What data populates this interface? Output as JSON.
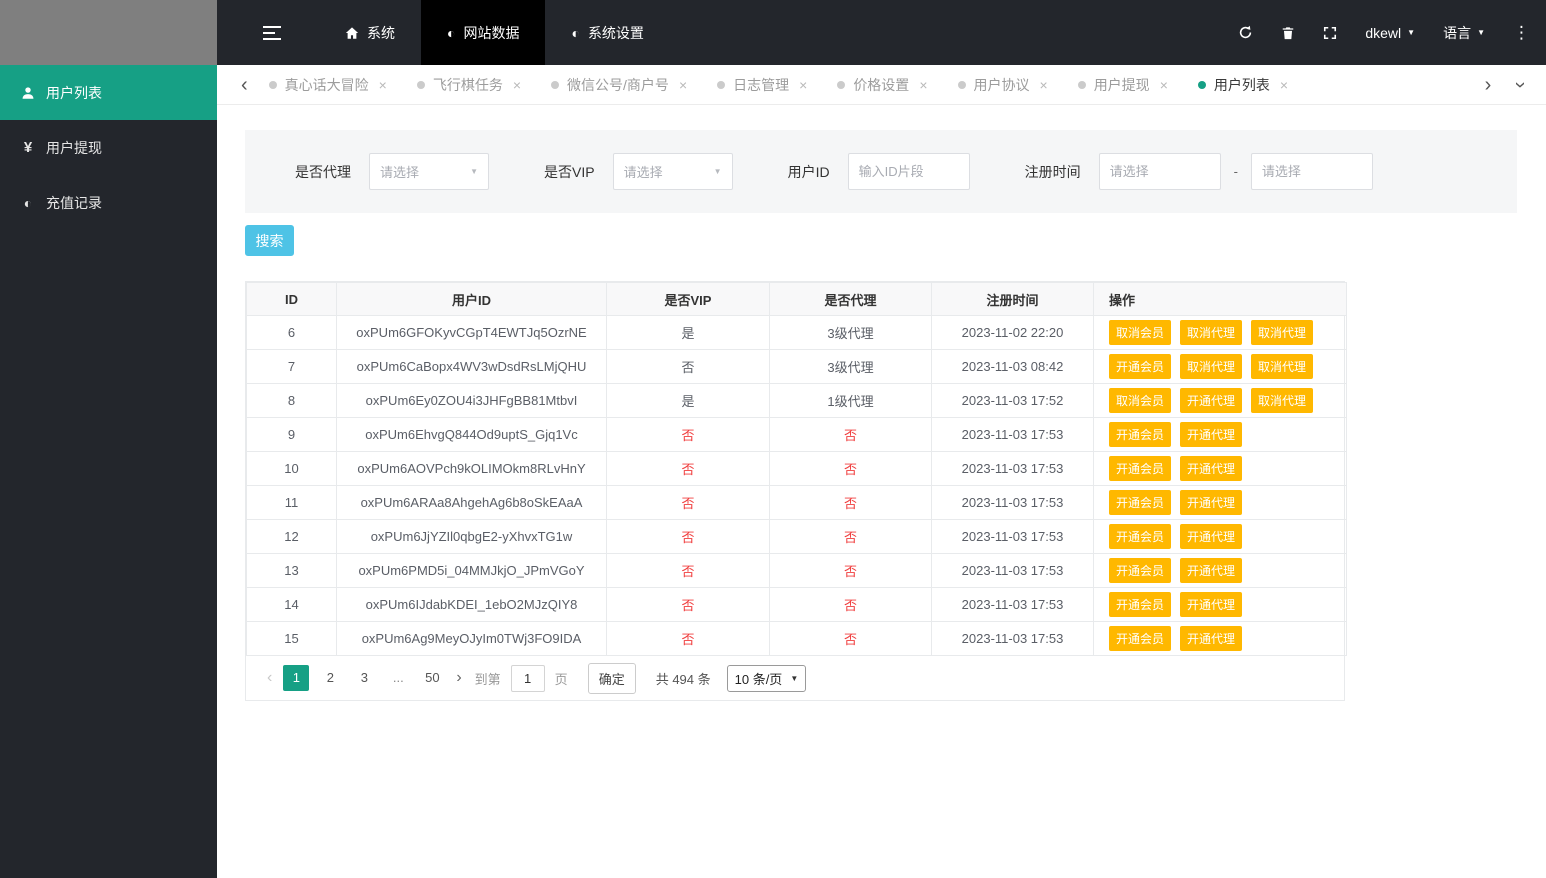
{
  "colors": {
    "accent_teal": "#16a085",
    "search_blue": "#4ec3e6",
    "action_orange": "#ffb800",
    "danger_red": "#f03e3e",
    "navbar_dark": "#23262c"
  },
  "navbar": {
    "items": [
      {
        "label": "系统",
        "icon": "home",
        "active": false
      },
      {
        "label": "网站数据",
        "icon": "pie",
        "active": true
      },
      {
        "label": "系统设置",
        "icon": "pie",
        "active": false
      }
    ],
    "username": "dkewl",
    "language_label": "语言"
  },
  "sidebar": {
    "items": [
      {
        "label": "用户列表",
        "icon": "user",
        "active": true
      },
      {
        "label": "用户提现",
        "icon": "yen",
        "active": false
      },
      {
        "label": "充值记录",
        "icon": "pie",
        "active": false
      }
    ]
  },
  "tabs": [
    {
      "label": "真心话大冒险",
      "active": false
    },
    {
      "label": "飞行棋任务",
      "active": false
    },
    {
      "label": "微信公号/商户号",
      "active": false
    },
    {
      "label": "日志管理",
      "active": false
    },
    {
      "label": "价格设置",
      "active": false
    },
    {
      "label": "用户协议",
      "active": false
    },
    {
      "label": "用户提现",
      "active": false
    },
    {
      "label": "用户列表",
      "active": true
    }
  ],
  "filters": {
    "agent_label": "是否代理",
    "vip_label": "是否VIP",
    "userid_label": "用户ID",
    "regtime_label": "注册时间",
    "select_placeholder": "请选择",
    "userid_placeholder": "输入ID片段",
    "date_placeholder": "请选择",
    "separator": "-",
    "search_label": "搜索"
  },
  "table": {
    "headers": [
      "ID",
      "用户ID",
      "是否VIP",
      "是否代理",
      "注册时间",
      "操作"
    ],
    "rows": [
      {
        "id": "6",
        "user_id": "oxPUm6GFOKyvCGpT4EWTJq5OzrNE",
        "vip": "是",
        "vip_red": false,
        "agent": "3级代理",
        "agent_red": false,
        "reg_time": "2023-11-02 22:20",
        "actions": [
          "取消会员",
          "取消代理",
          "取消代理"
        ]
      },
      {
        "id": "7",
        "user_id": "oxPUm6CaBopx4WV3wDsdRsLMjQHU",
        "vip": "否",
        "vip_red": false,
        "agent": "3级代理",
        "agent_red": false,
        "reg_time": "2023-11-03 08:42",
        "actions": [
          "开通会员",
          "取消代理",
          "取消代理"
        ]
      },
      {
        "id": "8",
        "user_id": "oxPUm6Ey0ZOU4i3JHFgBB81MtbvI",
        "vip": "是",
        "vip_red": false,
        "agent": "1级代理",
        "agent_red": false,
        "reg_time": "2023-11-03 17:52",
        "actions": [
          "取消会员",
          "开通代理",
          "取消代理"
        ]
      },
      {
        "id": "9",
        "user_id": "oxPUm6EhvgQ844Od9uptS_Gjq1Vc",
        "vip": "否",
        "vip_red": true,
        "agent": "否",
        "agent_red": true,
        "reg_time": "2023-11-03 17:53",
        "actions": [
          "开通会员",
          "开通代理"
        ]
      },
      {
        "id": "10",
        "user_id": "oxPUm6AOVPch9kOLIMOkm8RLvHnY",
        "vip": "否",
        "vip_red": true,
        "agent": "否",
        "agent_red": true,
        "reg_time": "2023-11-03 17:53",
        "actions": [
          "开通会员",
          "开通代理"
        ]
      },
      {
        "id": "11",
        "user_id": "oxPUm6ARAa8AhgehAg6b8oSkEAaA",
        "vip": "否",
        "vip_red": true,
        "agent": "否",
        "agent_red": true,
        "reg_time": "2023-11-03 17:53",
        "actions": [
          "开通会员",
          "开通代理"
        ]
      },
      {
        "id": "12",
        "user_id": "oxPUm6JjYZIl0qbgE2-yXhvxTG1w",
        "vip": "否",
        "vip_red": true,
        "agent": "否",
        "agent_red": true,
        "reg_time": "2023-11-03 17:53",
        "actions": [
          "开通会员",
          "开通代理"
        ]
      },
      {
        "id": "13",
        "user_id": "oxPUm6PMD5i_04MMJkjO_JPmVGoY",
        "vip": "否",
        "vip_red": true,
        "agent": "否",
        "agent_red": true,
        "reg_time": "2023-11-03 17:53",
        "actions": [
          "开通会员",
          "开通代理"
        ]
      },
      {
        "id": "14",
        "user_id": "oxPUm6IJdabKDEI_1ebO2MJzQIY8",
        "vip": "否",
        "vip_red": true,
        "agent": "否",
        "agent_red": true,
        "reg_time": "2023-11-03 17:53",
        "actions": [
          "开通会员",
          "开通代理"
        ]
      },
      {
        "id": "15",
        "user_id": "oxPUm6Ag9MeyOJyIm0TWj3FO9IDA",
        "vip": "否",
        "vip_red": true,
        "agent": "否",
        "agent_red": true,
        "reg_time": "2023-11-03 17:53",
        "actions": [
          "开通会员",
          "开通代理"
        ]
      }
    ]
  },
  "pagination": {
    "pages": [
      "1",
      "2",
      "3",
      "...",
      "50"
    ],
    "active_page": "1",
    "goto_label": "到第",
    "goto_value": "1",
    "page_label": "页",
    "confirm_label": "确定",
    "total_label": "共 494 条",
    "page_size": "10 条/页"
  },
  "icons": {
    "close": "×",
    "caret_down": "▼",
    "chevron_left": "‹",
    "chevron_right": "›",
    "more": "⋮"
  }
}
